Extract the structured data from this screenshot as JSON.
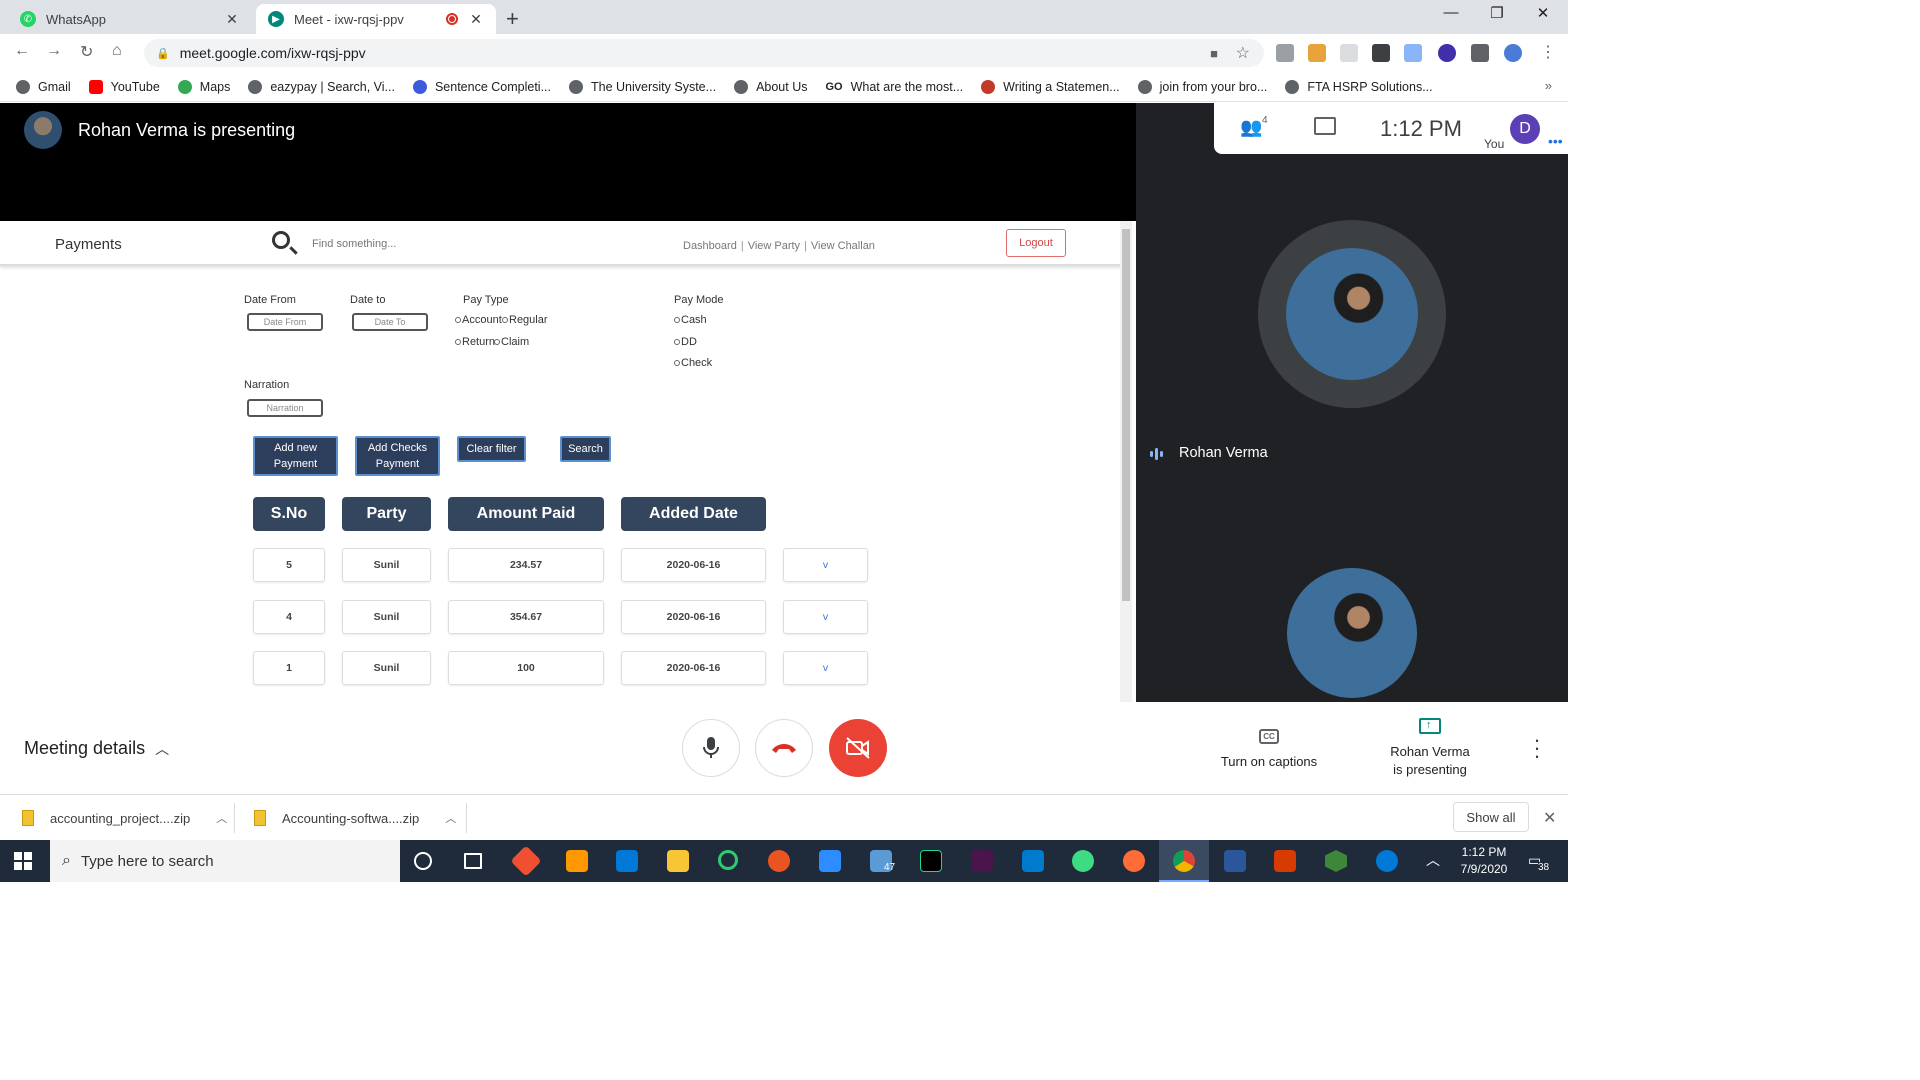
{
  "browser": {
    "tabs": [
      {
        "title": "WhatsApp",
        "active": false,
        "favicon_color": "#25d366"
      },
      {
        "title": "Meet - ixw-rqsj-ppv",
        "active": true,
        "favicon_color": "#00897b"
      }
    ],
    "url": "meet.google.com/ixw-rqsj-ppv",
    "bookmarks": [
      {
        "label": "Gmail",
        "color": "#5f6368"
      },
      {
        "label": "YouTube",
        "color": "#ff0000"
      },
      {
        "label": "Maps",
        "color": "#34a853"
      },
      {
        "label": "eazypay | Search, Vi...",
        "color": "#5f6368"
      },
      {
        "label": "Sentence Completi...",
        "color": "#3b5bdb"
      },
      {
        "label": "The University Syste...",
        "color": "#5f6368"
      },
      {
        "label": "About Us",
        "color": "#5f6368"
      },
      {
        "label": "What are the most...",
        "color": "#202124"
      },
      {
        "label": "Writing a Statemen...",
        "color": "#c0392b"
      },
      {
        "label": "join from your bro...",
        "color": "#5f6368"
      },
      {
        "label": "FTA HSRP Solutions...",
        "color": "#5f6368"
      }
    ]
  },
  "meet": {
    "presenter_banner": "Rohan Verma is presenting",
    "participant_count": "4",
    "clock": "1:12 PM",
    "self_label": "You",
    "self_initial": "D",
    "speaker_name": "Rohan Verma",
    "meeting_details": "Meeting details",
    "captions_label": "Turn on captions",
    "presenting_line1": "Rohan Verma",
    "presenting_line2": "is presenting"
  },
  "shared_app": {
    "title": "Payments",
    "search_placeholder": "Find something...",
    "nav": [
      "Dashboard",
      "View Party",
      "View Challan"
    ],
    "logout": "Logout",
    "filters": {
      "date_from_label": "Date From",
      "date_from_placeholder": "Date From",
      "date_to_label": "Date to",
      "date_to_placeholder": "Date To",
      "pay_type_label": "Pay Type",
      "pay_type_options": [
        "Account",
        "Regular",
        "Return",
        "Claim"
      ],
      "pay_mode_label": "Pay Mode",
      "pay_mode_options": [
        "Cash",
        "DD",
        "Check"
      ],
      "narration_label": "Narration",
      "narration_placeholder": "Narration"
    },
    "buttons": {
      "add_payment_line1": "Add new",
      "add_payment_line2": "Payment",
      "add_checks_line1": "Add Checks",
      "add_checks_line2": "Payment",
      "clear_filter": "Clear filter",
      "search": "Search"
    },
    "columns": [
      "S.No",
      "Party",
      "Amount Paid",
      "Added Date"
    ],
    "rows": [
      {
        "sno": "5",
        "party": "Sunil",
        "amount": "234.57",
        "date": "2020-06-16",
        "action": "v"
      },
      {
        "sno": "4",
        "party": "Sunil",
        "amount": "354.67",
        "date": "2020-06-16",
        "action": "v"
      },
      {
        "sno": "1",
        "party": "Sunil",
        "amount": "100",
        "date": "2020-06-16",
        "action": "v"
      }
    ]
  },
  "downloads": [
    {
      "name": "accounting_project....zip"
    },
    {
      "name": "Accounting-softwa....zip"
    }
  ],
  "downloads_show_all": "Show all",
  "taskbar": {
    "search_placeholder": "Type here to search",
    "time": "1:12 PM",
    "date": "7/9/2020",
    "mail_badge": "47",
    "notification_count": "38"
  }
}
